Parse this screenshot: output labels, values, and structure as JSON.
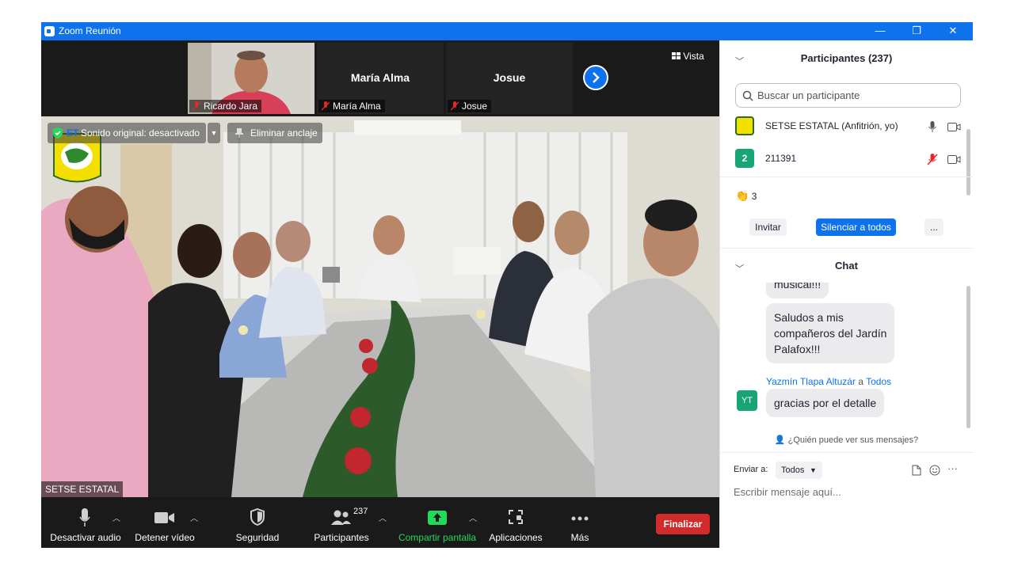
{
  "window": {
    "title": "Zoom Reunión",
    "controls": {
      "minimize": "—",
      "restore": "❐",
      "close": "✕"
    }
  },
  "strip": {
    "tiles": [
      {
        "name": "",
        "label": "Ricardo Jara"
      },
      {
        "name": "María Alma",
        "label": "María Alma"
      },
      {
        "name": "Josue",
        "label": "Josue"
      }
    ],
    "view_label": "Vista"
  },
  "main_video": {
    "badge_text": "ET",
    "original_sound": "Sonido original: desactivado",
    "unpin": "Eliminar anclaje",
    "speaker": "SETSE ESTATAL"
  },
  "toolbar": {
    "mute": "Desactivar audio",
    "video": "Detener vídeo",
    "security": "Seguridad",
    "participants": "Participantes",
    "participants_count": "237",
    "share": "Compartir pantalla",
    "apps": "Aplicaciones",
    "more": "Más",
    "end": "Finalizar"
  },
  "participants": {
    "header": "Participantes (237)",
    "search_placeholder": "Buscar un participante",
    "list": [
      {
        "name": "SETSE ESTATAL (Anfitrión, yo)",
        "avatar": ""
      },
      {
        "name": "211391",
        "avatar": "2"
      }
    ],
    "reactions": "3",
    "invite": "Invitar",
    "mute_all": "Silenciar a todos",
    "more": "..."
  },
  "chat": {
    "header": "Chat",
    "messages": [
      {
        "text": "musical!!!"
      },
      {
        "text_lines": [
          "Saludos a mis",
          "compañeros del Jardín",
          "Palafox!!!"
        ]
      }
    ],
    "sender": {
      "name": "Yazmín Tlapa Altuzár",
      "to_word": "a",
      "to": "Todos",
      "initials": "YT"
    },
    "last_message": "gracias por el detalle",
    "visibility": "¿Quién puede ver sus mensajes?",
    "send_to_label": "Enviar a:",
    "send_to_value": "Todos",
    "input_placeholder": "Escribir mensaje aquí...",
    "more": "···"
  },
  "colors": {
    "zoom_blue": "#0e72ed",
    "end_red": "#d12b2b",
    "share_green": "#23d959"
  }
}
